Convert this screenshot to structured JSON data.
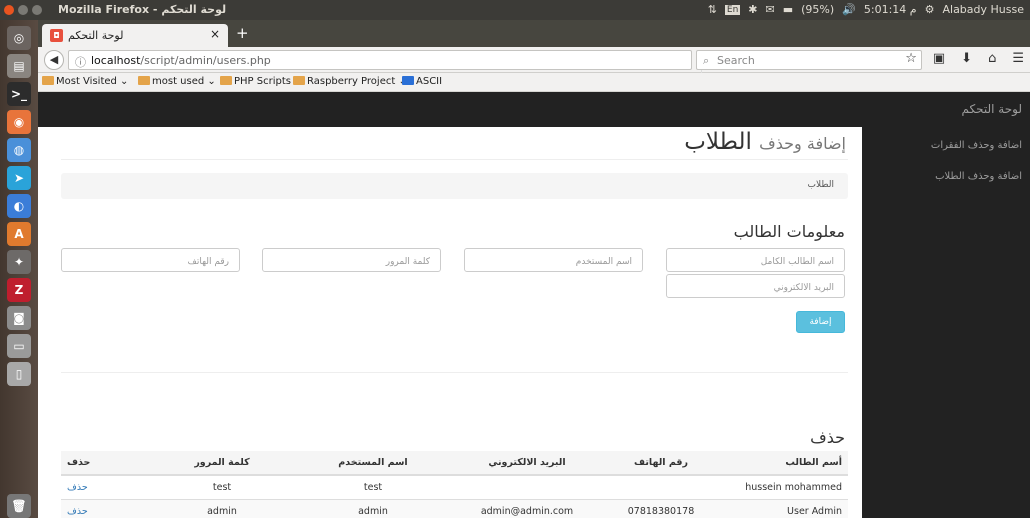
{
  "os": {
    "window_title": "Mozilla Firefox - لوحة التحكم",
    "status_keyboard": "En",
    "status_battery": "(95%)",
    "status_clock": "م 5:01:14",
    "status_user": "Alabady Husse"
  },
  "browser": {
    "tab_title": "لوحة التحكم",
    "tab_close": "×",
    "new_tab": "+",
    "url_host": "localhost",
    "url_path": "/script/admin/users.php",
    "search_placeholder": "Search",
    "bookmarks": [
      "Most Visited",
      "most used",
      "PHP Scripts",
      "Raspberry Project",
      "ASCII"
    ]
  },
  "app": {
    "brand": "لوحة التحكم",
    "sidebar": [
      "اضافة وحذف الفقرات",
      "اضافة وحذف الطلاب"
    ]
  },
  "page": {
    "title": "الطلاب",
    "subtitle": "إضافة وحذف",
    "breadcrumb": "الطلاب",
    "form_title": "معلومات الطالب",
    "fields": {
      "full_name": "أسم الطالب الكامل",
      "username": "اسم المستخدم",
      "password": "كلمة المرور",
      "phone": "رقم الهاتف",
      "email": "البريد الالكتروني"
    },
    "add_button": "إضافة",
    "delete_title": "حذف"
  },
  "table": {
    "headers": [
      "أسم الطالب",
      "رقم الهاتف",
      "البريد الالكتروني",
      "اسم المستخدم",
      "كلمة المرور",
      "حذف"
    ],
    "rows": [
      {
        "name": "hussein mohammed",
        "phone": "",
        "email": "",
        "username": "test",
        "password": "test",
        "action": "حذف"
      },
      {
        "name": "User Admin",
        "phone": "07818380178",
        "email": "admin@admin.com",
        "username": "admin",
        "password": "admin",
        "action": "حذف"
      }
    ]
  },
  "colors": {
    "accent": "#5bc0de",
    "navbar": "#222222",
    "link": "#337ab7",
    "ubuntu_topbar": "#3c3b37"
  }
}
